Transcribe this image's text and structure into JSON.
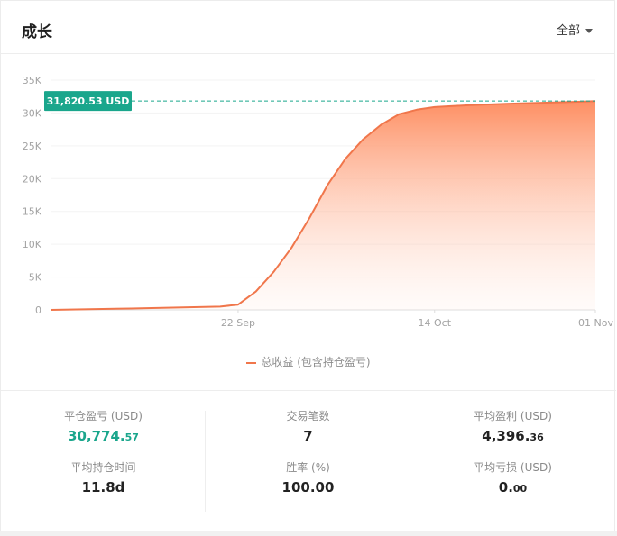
{
  "header": {
    "title": "成长",
    "filter_label": "全部"
  },
  "chart_data": {
    "type": "area",
    "y_ticks": [
      "35K",
      "30K",
      "25K",
      "20K",
      "15K",
      "10K",
      "5K",
      "0"
    ],
    "ylim": [
      0,
      35000
    ],
    "x_ticks": [
      "22 Sep",
      "14 Oct",
      "01 Nov"
    ],
    "x": [
      "09-01",
      "09-10",
      "09-20",
      "09-22",
      "09-24",
      "09-26",
      "09-28",
      "09-30",
      "10-02",
      "10-04",
      "10-06",
      "10-08",
      "10-10",
      "10-12",
      "10-14",
      "10-18",
      "10-22",
      "10-26",
      "10-30",
      "11-01"
    ],
    "series": [
      {
        "name": "总收益 (包含持仓盈亏)",
        "values": [
          0,
          200,
          500,
          800,
          2800,
          5800,
          9500,
          14000,
          19000,
          23000,
          26000,
          28200,
          29800,
          30500,
          30900,
          31200,
          31400,
          31550,
          31700,
          31820.53
        ]
      }
    ],
    "current_label": "31,820.53 USD",
    "current_value": 31820.53,
    "line_color": "#f0764b",
    "label_color": "#1aa68c",
    "grid": true
  },
  "stats": {
    "closed_pnl": {
      "label": "平仓盈亏 (USD)",
      "int": "30,774.",
      "dec": "57"
    },
    "trade_count": {
      "label": "交易笔数",
      "int": "7",
      "dec": ""
    },
    "avg_profit": {
      "label": "平均盈利 (USD)",
      "int": "4,396.",
      "dec": "36"
    },
    "avg_hold_time": {
      "label": "平均持仓时间",
      "int": "11.8d",
      "dec": ""
    },
    "win_rate": {
      "label": "胜率 (%)",
      "int": "100.00",
      "dec": ""
    },
    "avg_loss": {
      "label": "平均亏损 (USD)",
      "int": "0.",
      "dec": "00"
    }
  }
}
